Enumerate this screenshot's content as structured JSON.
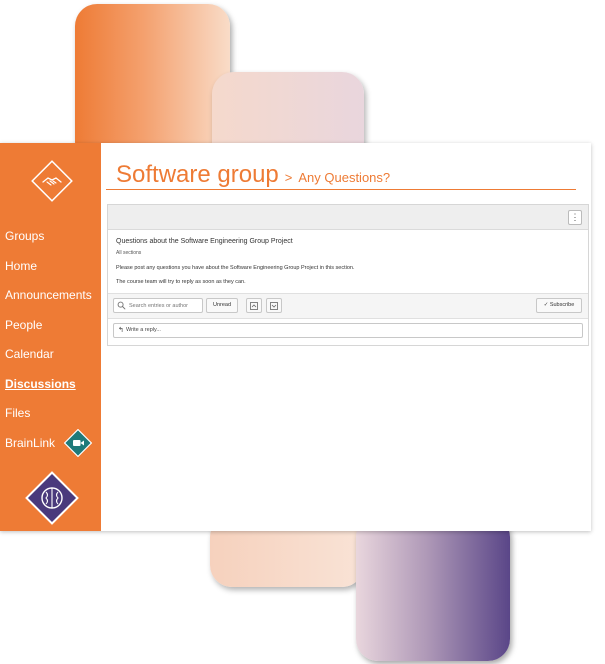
{
  "colors": {
    "accent": "#ee7b35",
    "brand_purple": "#4a3a7c",
    "brainlink_teal": "#1f7a7a"
  },
  "sidebar": {
    "logo_icon": "handshake-icon",
    "items": [
      {
        "label": "Groups"
      },
      {
        "label": "Home"
      },
      {
        "label": "Announcements"
      },
      {
        "label": "People"
      },
      {
        "label": "Calendar"
      },
      {
        "label": "Discussions",
        "active": true
      },
      {
        "label": "Files"
      },
      {
        "label": "BrainLink",
        "icon": "video-camera-icon"
      }
    ],
    "footer_icon": "brain-icon"
  },
  "header": {
    "title": "Software group",
    "separator": ">",
    "subtitle": "Any Questions?"
  },
  "discussion": {
    "title": "Questions about the Software Engineering Group Project",
    "sections": "All sections",
    "body_1": "Please post any questions you have about the Software Engineering Group Project in this section.",
    "body_2": "The course team will try to reply as soon as they can.",
    "menu_icon": "vertical-dots-icon"
  },
  "toolbar": {
    "search_placeholder": "Search entries or author",
    "unread_label": "Unread",
    "expand_icon": "expand-icon",
    "collapse_icon": "collapse-icon",
    "subscribe_label": "Subscribe",
    "subscribe_check": "✓"
  },
  "reply": {
    "placeholder": "Write a reply...",
    "icon": "reply-arrow-icon"
  }
}
